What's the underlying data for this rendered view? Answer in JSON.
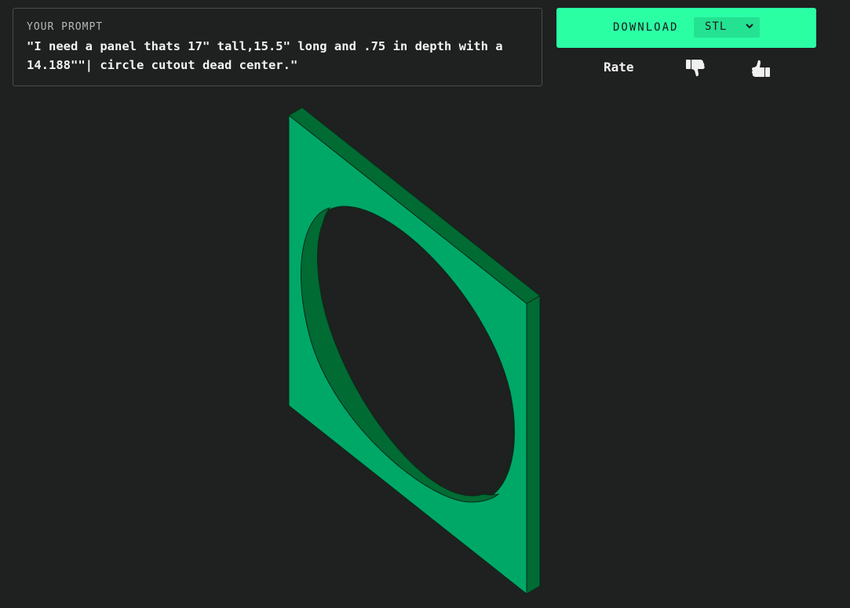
{
  "prompt": {
    "label": "YOUR PROMPT",
    "text": "\"I need a panel thats 17\" tall,15.5\" long and .75 in depth with a 14.188\"\"| circle cutout dead center.\""
  },
  "download": {
    "label": "DOWNLOAD",
    "format_selected": "STL"
  },
  "rating": {
    "label": "Rate",
    "thumbs_down_icon": "thumbs-down-icon",
    "thumbs_up_icon": "thumbs-up-icon"
  },
  "viewer": {
    "model": "panel-with-circle-cutout"
  },
  "colors": {
    "background": "#1f2020",
    "accent": "#2bffa4",
    "panel_face": "#00a868",
    "panel_edge": "#006b33"
  }
}
